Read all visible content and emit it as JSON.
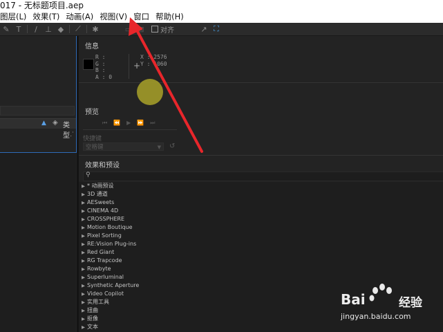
{
  "window": {
    "title": "017 - 无标题项目.aep"
  },
  "menu": [
    {
      "label": "图层(L)"
    },
    {
      "label": "效果(T)"
    },
    {
      "label": "动画(A)"
    },
    {
      "label": "视图(V)"
    },
    {
      "label": "窗口"
    },
    {
      "label": "帮助(H)"
    }
  ],
  "toolbar": {
    "snap_label": "对齐"
  },
  "project_panel": {
    "column_label": "类型"
  },
  "info_panel": {
    "title": "信息",
    "r": "R :",
    "g": "G :",
    "b": "B :",
    "a": "A : 0",
    "x": "X : 2576",
    "y": "Y : 1060",
    "plus": "+"
  },
  "preview_panel": {
    "title": "预览",
    "shortcut_label": "快捷键",
    "shortcut_value": "空格键"
  },
  "effects_panel": {
    "title": "效果和预设",
    "search_icon": "search-icon",
    "items": [
      "* 动画预设",
      "3D 通道",
      "AESweets",
      "CINEMA 4D",
      "CROSSPHERE",
      "Motion Boutique",
      "Pixel Sorting",
      "RE:Vision Plug-ins",
      "Red Giant",
      "RG Trapcode",
      "Rowbyte",
      "Superluminal",
      "Synthetic Aperture",
      "Video Copilot",
      "实用工具",
      "扭曲",
      "抠像",
      "文本"
    ]
  },
  "watermark": {
    "brand": "Bai",
    "brand_suffix": "经验",
    "url": "jingyan.baidu.com"
  },
  "colors": {
    "accent_blue": "#2e6bb8",
    "annotation_red": "#e8262b",
    "highlight_yellow": "#a9a229"
  }
}
